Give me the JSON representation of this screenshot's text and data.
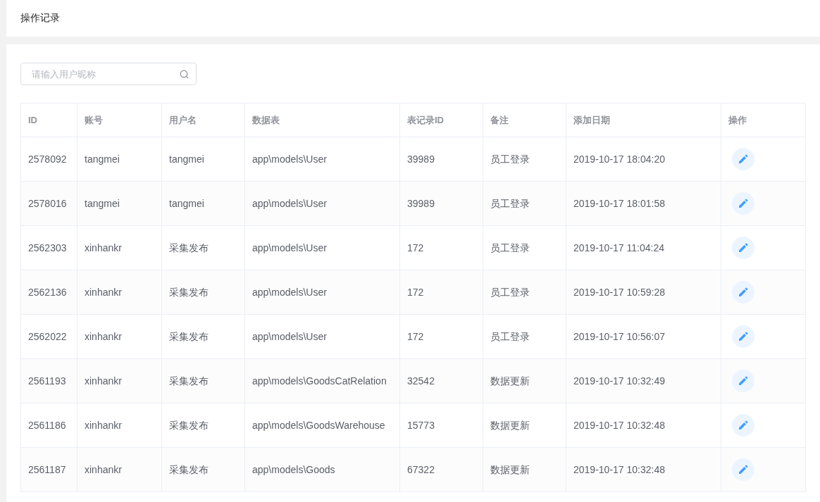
{
  "page_title": "操作记录",
  "search": {
    "placeholder": "请输入用户昵称"
  },
  "table": {
    "columns": [
      "ID",
      "账号",
      "用户名",
      "数据表",
      "表记录ID",
      "备注",
      "添加日期",
      "操作"
    ],
    "rows": [
      {
        "id": "2578092",
        "account": "tangmei",
        "username": "tangmei",
        "table": "app\\models\\User",
        "record_id": "39989",
        "note": "员工登录",
        "date": "2019-10-17 18:04:20"
      },
      {
        "id": "2578016",
        "account": "tangmei",
        "username": "tangmei",
        "table": "app\\models\\User",
        "record_id": "39989",
        "note": "员工登录",
        "date": "2019-10-17 18:01:58"
      },
      {
        "id": "2562303",
        "account": "xinhankr",
        "username": "采集发布",
        "table": "app\\models\\User",
        "record_id": "172",
        "note": "员工登录",
        "date": "2019-10-17 11:04:24"
      },
      {
        "id": "2562136",
        "account": "xinhankr",
        "username": "采集发布",
        "table": "app\\models\\User",
        "record_id": "172",
        "note": "员工登录",
        "date": "2019-10-17 10:59:28"
      },
      {
        "id": "2562022",
        "account": "xinhankr",
        "username": "采集发布",
        "table": "app\\models\\User",
        "record_id": "172",
        "note": "员工登录",
        "date": "2019-10-17 10:56:07"
      },
      {
        "id": "2561193",
        "account": "xinhankr",
        "username": "采集发布",
        "table": "app\\models\\GoodsCatRelation",
        "record_id": "32542",
        "note": "数据更新",
        "date": "2019-10-17 10:32:49"
      },
      {
        "id": "2561186",
        "account": "xinhankr",
        "username": "采集发布",
        "table": "app\\models\\GoodsWarehouse",
        "record_id": "15773",
        "note": "数据更新",
        "date": "2019-10-17 10:32:48"
      },
      {
        "id": "2561187",
        "account": "xinhankr",
        "username": "采集发布",
        "table": "app\\models\\Goods",
        "record_id": "67322",
        "note": "数据更新",
        "date": "2019-10-17 10:32:48"
      }
    ]
  }
}
